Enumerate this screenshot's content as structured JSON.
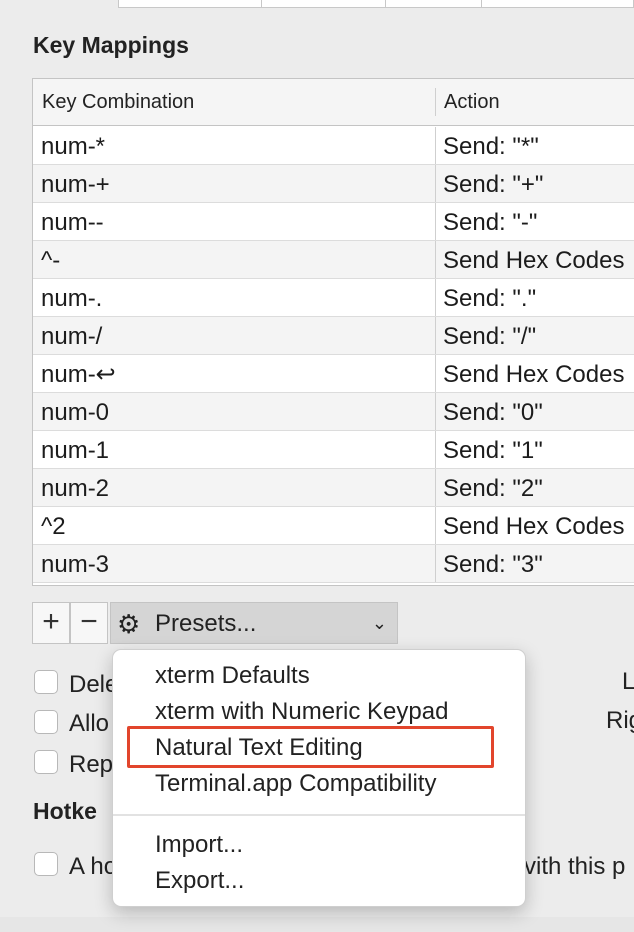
{
  "key_mappings": {
    "title": "Key Mappings",
    "columns": {
      "key": "Key Combination",
      "action": "Action"
    },
    "rows": [
      {
        "key": "num-*",
        "action": "Send: \"*\""
      },
      {
        "key": "num-+",
        "action": "Send: \"+\""
      },
      {
        "key": "num--",
        "action": "Send: \"-\""
      },
      {
        "key": "^-",
        "action": "Send Hex Codes"
      },
      {
        "key": "num-.",
        "action": "Send: \".\""
      },
      {
        "key": "num-/",
        "action": "Send: \"/\""
      },
      {
        "key": "num-↩",
        "action": "Send Hex Codes"
      },
      {
        "key": "num-0",
        "action": "Send: \"0\""
      },
      {
        "key": "num-1",
        "action": "Send: \"1\""
      },
      {
        "key": "num-2",
        "action": "Send: \"2\""
      },
      {
        "key": "^2",
        "action": "Send Hex Codes"
      },
      {
        "key": "num-3",
        "action": "Send: \"3\""
      }
    ]
  },
  "toolbar": {
    "add_label": "+",
    "remove_label": "−",
    "presets_label": "Presets...",
    "gear_icon": "gear-icon",
    "chevron_icon": "chevron-down-icon"
  },
  "options": [
    {
      "label": "Dele"
    },
    {
      "label": "Allo"
    },
    {
      "label": "Rep"
    }
  ],
  "right_labels": {
    "l": "L",
    "rig": "Rig"
  },
  "hotkey": {
    "title": "Hotke",
    "option_left": "A ho",
    "option_right": "vith this p"
  },
  "presets_menu": {
    "items": [
      "xterm Defaults",
      "xterm with Numeric Keypad",
      "Natural Text Editing",
      "Terminal.app Compatibility"
    ],
    "actions": [
      "Import...",
      "Export..."
    ],
    "highlighted_index": 2,
    "highlight_color": "#e2452c"
  }
}
